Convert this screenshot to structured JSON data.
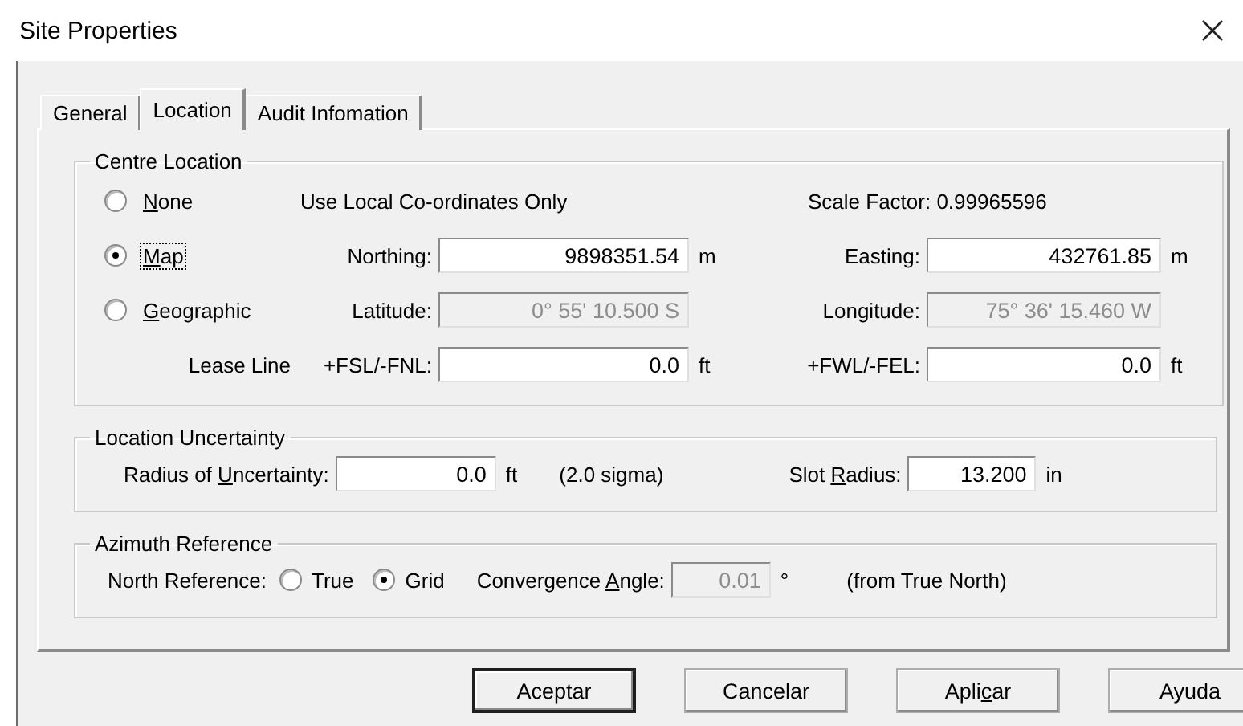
{
  "window": {
    "title": "Site Properties"
  },
  "tabs": [
    {
      "label": "General",
      "selected": false
    },
    {
      "label": "Location",
      "selected": true
    },
    {
      "label": "Audit Infomation",
      "selected": false
    }
  ],
  "centre_location": {
    "title": "Centre Location",
    "rows": [
      {
        "kind": "info",
        "radio": {
          "label": {
            "key": "N",
            "post": "one"
          },
          "selected": false,
          "focused": false
        },
        "note": "Use Local Co-ordinates Only",
        "aside": "Scale Factor: 0.99965596"
      },
      {
        "kind": "fields",
        "radio": {
          "label": {
            "key": "M",
            "post": "ap"
          },
          "selected": true,
          "focused": true
        },
        "fields": [
          {
            "label": "Northing:",
            "value": "9898351.54",
            "unit": "m",
            "disabled": false
          },
          {
            "label": "Easting:",
            "value": "432761.85",
            "unit": "m",
            "disabled": false
          }
        ]
      },
      {
        "kind": "fields",
        "radio": {
          "label": {
            "key": "G",
            "post": "eographic"
          },
          "selected": false,
          "focused": false
        },
        "fields": [
          {
            "label": "Latitude:",
            "value": "0° 55' 10.500 S",
            "disabled": true
          },
          {
            "label": "Longitude:",
            "value": "75° 36' 15.460 W",
            "disabled": true
          }
        ]
      },
      {
        "kind": "fields",
        "caption": "Lease Line",
        "fields": [
          {
            "label": "+FSL/-FNL:",
            "value": "0.0",
            "unit": "ft",
            "disabled": false
          },
          {
            "label": "+FWL/-FEL:",
            "value": "0.0",
            "unit": "ft",
            "disabled": false
          }
        ]
      }
    ]
  },
  "location_uncertainty": {
    "title": "Location Uncertainty",
    "radius": {
      "label": {
        "pre": "Radius of ",
        "key": "U",
        "post": "ncertainty:"
      },
      "value": "0.0",
      "unit": "ft",
      "disabled": false
    },
    "sigma": "(2.0 sigma)",
    "slot": {
      "label": {
        "pre": "Slot ",
        "key": "R",
        "post": "adius:"
      },
      "value": "13.200",
      "unit": "in",
      "disabled": false
    }
  },
  "azimuth_reference": {
    "title": "Azimuth Reference",
    "north_label": "North Reference:",
    "north_options": [
      {
        "label": "True",
        "selected": false
      },
      {
        "label": "Grid",
        "selected": true
      }
    ],
    "convergence": {
      "label": {
        "pre": "Convergence ",
        "key": "A",
        "post": "ngle:"
      },
      "value": "0.01",
      "unit": "°",
      "disabled": true
    },
    "note": "(from True North)"
  },
  "buttons": [
    {
      "label": {
        "pre": "Aceptar"
      },
      "default": true
    },
    {
      "label": {
        "pre": "Cancelar"
      },
      "default": false
    },
    {
      "label": {
        "pre": "Apli",
        "key": "c",
        "post": "ar"
      },
      "default": false
    },
    {
      "label": {
        "pre": "Ayuda"
      },
      "default": false
    }
  ]
}
